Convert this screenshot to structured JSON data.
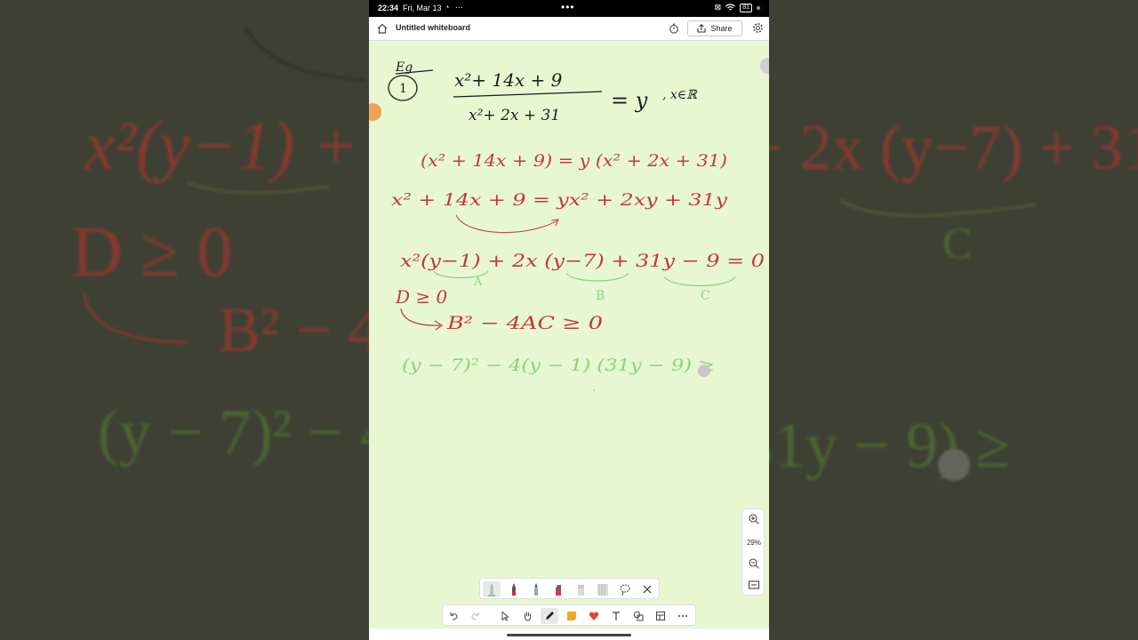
{
  "status_bar": {
    "time": "22:34",
    "date": "Fri, Mar 13",
    "battery": "81"
  },
  "app": {
    "title": "Untitled whiteboard",
    "share_label": "Share"
  },
  "zoom": {
    "level": "29%"
  },
  "colors": {
    "canvas": "#e7f7d2",
    "red_ink": "#c33a38",
    "green_ink": "#8fd07d",
    "black_ink": "#1c1c1c"
  },
  "ink": {
    "example_label": "Eg",
    "example_number": "1",
    "numerator": "x²+ 14x + 9",
    "denominator": "x²+ 2x + 31",
    "equals_y": "= y",
    "domain": ", x∈ℝ",
    "step1": "(x² + 14x + 9) = y (x² + 2x + 31)",
    "step2": "x² + 14x + 9  =  yx² + 2xy + 31y",
    "step3": "x²(y−1) + 2x (y−7) + 31y − 9 = 0",
    "label_a": "A",
    "label_b": "B",
    "label_c": "C",
    "cond": "D ≥ 0",
    "disc": "B² − 4AC ≥ 0",
    "step4": "(y − 7)² − 4(y − 1) (31y − 9) ≥"
  }
}
